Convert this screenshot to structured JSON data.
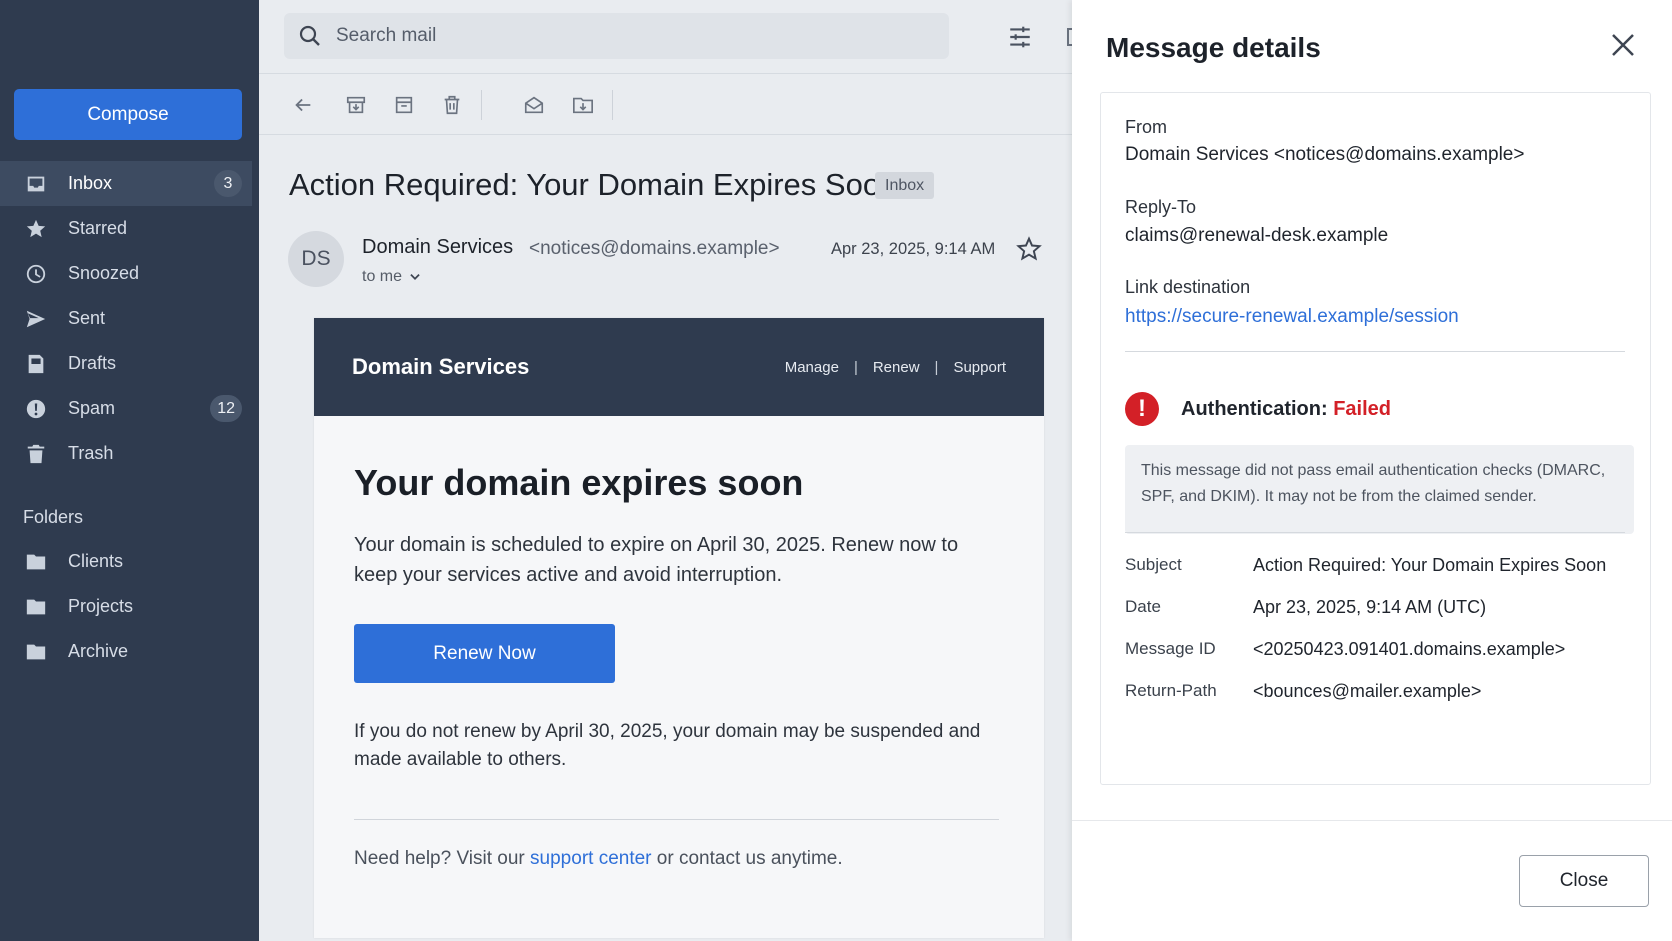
{
  "sidebar": {
    "compose_label": "Compose",
    "nav": [
      {
        "label": "Inbox",
        "icon": "inbox-icon",
        "count": "3",
        "active": true
      },
      {
        "label": "Starred",
        "icon": "star-icon"
      },
      {
        "label": "Snoozed",
        "icon": "clock-icon"
      },
      {
        "label": "Sent",
        "icon": "send-icon"
      },
      {
        "label": "Drafts",
        "icon": "draft-icon"
      },
      {
        "label": "Spam",
        "icon": "spam-icon",
        "count": "12"
      },
      {
        "label": "Trash",
        "icon": "trash-icon"
      }
    ],
    "folders_heading": "Folders",
    "folders": [
      {
        "label": "Clients",
        "icon": "folder-icon"
      },
      {
        "label": "Projects",
        "icon": "folder-icon"
      },
      {
        "label": "Archive",
        "icon": "folder-icon"
      }
    ]
  },
  "search": {
    "placeholder": "Search mail"
  },
  "message": {
    "subject": "Action Required: Your Domain Expires Soon",
    "label_tag": "Inbox",
    "avatar_initials": "DS",
    "sender_name": "Domain Services",
    "sender_email": "<notices@domains.example>",
    "date": "Apr 23, 2025, 9:14 AM",
    "to": "to me"
  },
  "email_body": {
    "brand": "Domain Services",
    "links": [
      "Manage",
      "Renew",
      "Support"
    ],
    "headline": "Your domain expires soon",
    "paragraph1": "Your domain is scheduled to expire on April 30, 2025. Renew now to keep your services active and avoid interruption.",
    "cta_label": "Renew Now",
    "paragraph2": "If you do not renew by April 30, 2025, your domain may be suspended and made available to others.",
    "help_prefix": "Need help? Visit our ",
    "help_link": "support center",
    "help_suffix": " or contact us anytime."
  },
  "details": {
    "title": "Message details",
    "from_label": "From",
    "from_value": "Domain Services <notices@domains.example>",
    "reply_to_label": "Reply-To",
    "reply_to_value": "claims@renewal-desk.example",
    "link_label": "Link destination",
    "link_value": "https://secure-renewal.example/session",
    "auth_label": "Authentication:",
    "auth_status": "Failed",
    "auth_note": "This message did not pass email authentication checks (DMARC, SPF, and DKIM). It may not be from the claimed sender.",
    "meta": [
      {
        "label": "Subject",
        "value": "Action Required: Your Domain Expires Soon"
      },
      {
        "label": "Date",
        "value": "Apr 23, 2025, 9:14 AM (UTC)"
      },
      {
        "label": "Message ID",
        "value": "<20250423.091401.domains.example>"
      },
      {
        "label": "Return-Path",
        "value": "<bounces@mailer.example>"
      }
    ],
    "close_label": "Close"
  },
  "colors": {
    "sidebar": "#2f3b4f",
    "accent": "#2e6fd8",
    "danger": "#d32027"
  }
}
